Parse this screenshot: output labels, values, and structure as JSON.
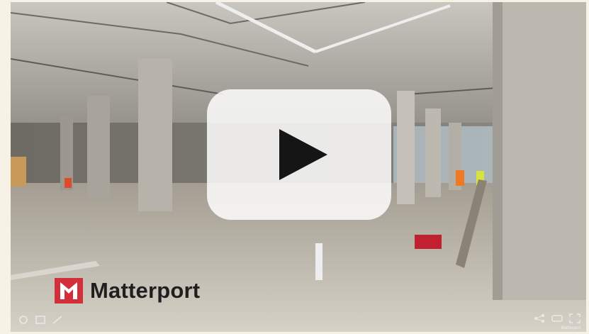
{
  "brand": {
    "name": "Matterport",
    "logo_color": "#d32f3a"
  },
  "player": {
    "play_icon": "play-icon",
    "accent": "#ffffff"
  },
  "controls": {
    "left": [
      "walk-icon",
      "floorplan-icon",
      "measure-icon"
    ],
    "right": [
      "share-icon",
      "vr-icon",
      "fullscreen-icon"
    ]
  },
  "watermark": {
    "text": "Matterport"
  }
}
